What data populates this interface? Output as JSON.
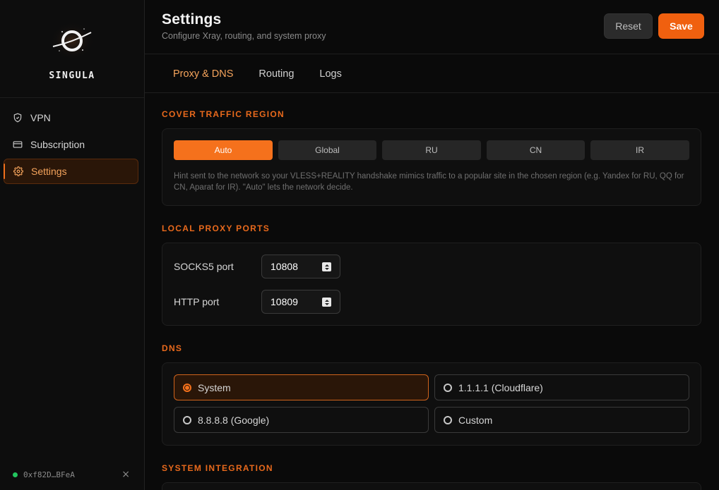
{
  "brand": {
    "name": "SINGULA"
  },
  "sidebar": {
    "items": [
      {
        "label": "VPN",
        "icon": "shield-icon"
      },
      {
        "label": "Subscription",
        "icon": "card-icon"
      },
      {
        "label": "Settings",
        "icon": "gear-icon",
        "active": true
      }
    ],
    "wallet": {
      "address": "0xf82D…BFeA",
      "status_color": "#22c55e",
      "close": "×"
    }
  },
  "header": {
    "title": "Settings",
    "subtitle": "Configure Xray, routing, and system proxy",
    "reset_label": "Reset",
    "save_label": "Save"
  },
  "tabs": [
    {
      "label": "Proxy & DNS",
      "active": true
    },
    {
      "label": "Routing"
    },
    {
      "label": "Logs"
    }
  ],
  "sections": {
    "region": {
      "title": "COVER TRAFFIC REGION",
      "options": [
        "Auto",
        "Global",
        "RU",
        "CN",
        "IR"
      ],
      "selected": "Auto",
      "hint": "Hint sent to the network so your VLESS+REALITY handshake mimics traffic to a popular site in the chosen region (e.g. Yandex for RU, QQ for CN, Aparat for IR). \"Auto\" lets the network decide."
    },
    "ports": {
      "title": "LOCAL PROXY PORTS",
      "socks_label": "SOCKS5 port",
      "socks_value": "10808",
      "http_label": "HTTP port",
      "http_value": "10809"
    },
    "dns": {
      "title": "DNS",
      "options": [
        "System",
        "1.1.1.1 (Cloudflare)",
        "8.8.8.8 (Google)",
        "Custom"
      ],
      "selected": "System"
    },
    "system": {
      "title": "SYSTEM INTEGRATION"
    }
  },
  "colors": {
    "accent": "#f0600f",
    "accent_text": "#f5a45c",
    "section_title": "#e8691c",
    "background": "#0a0a0a"
  }
}
